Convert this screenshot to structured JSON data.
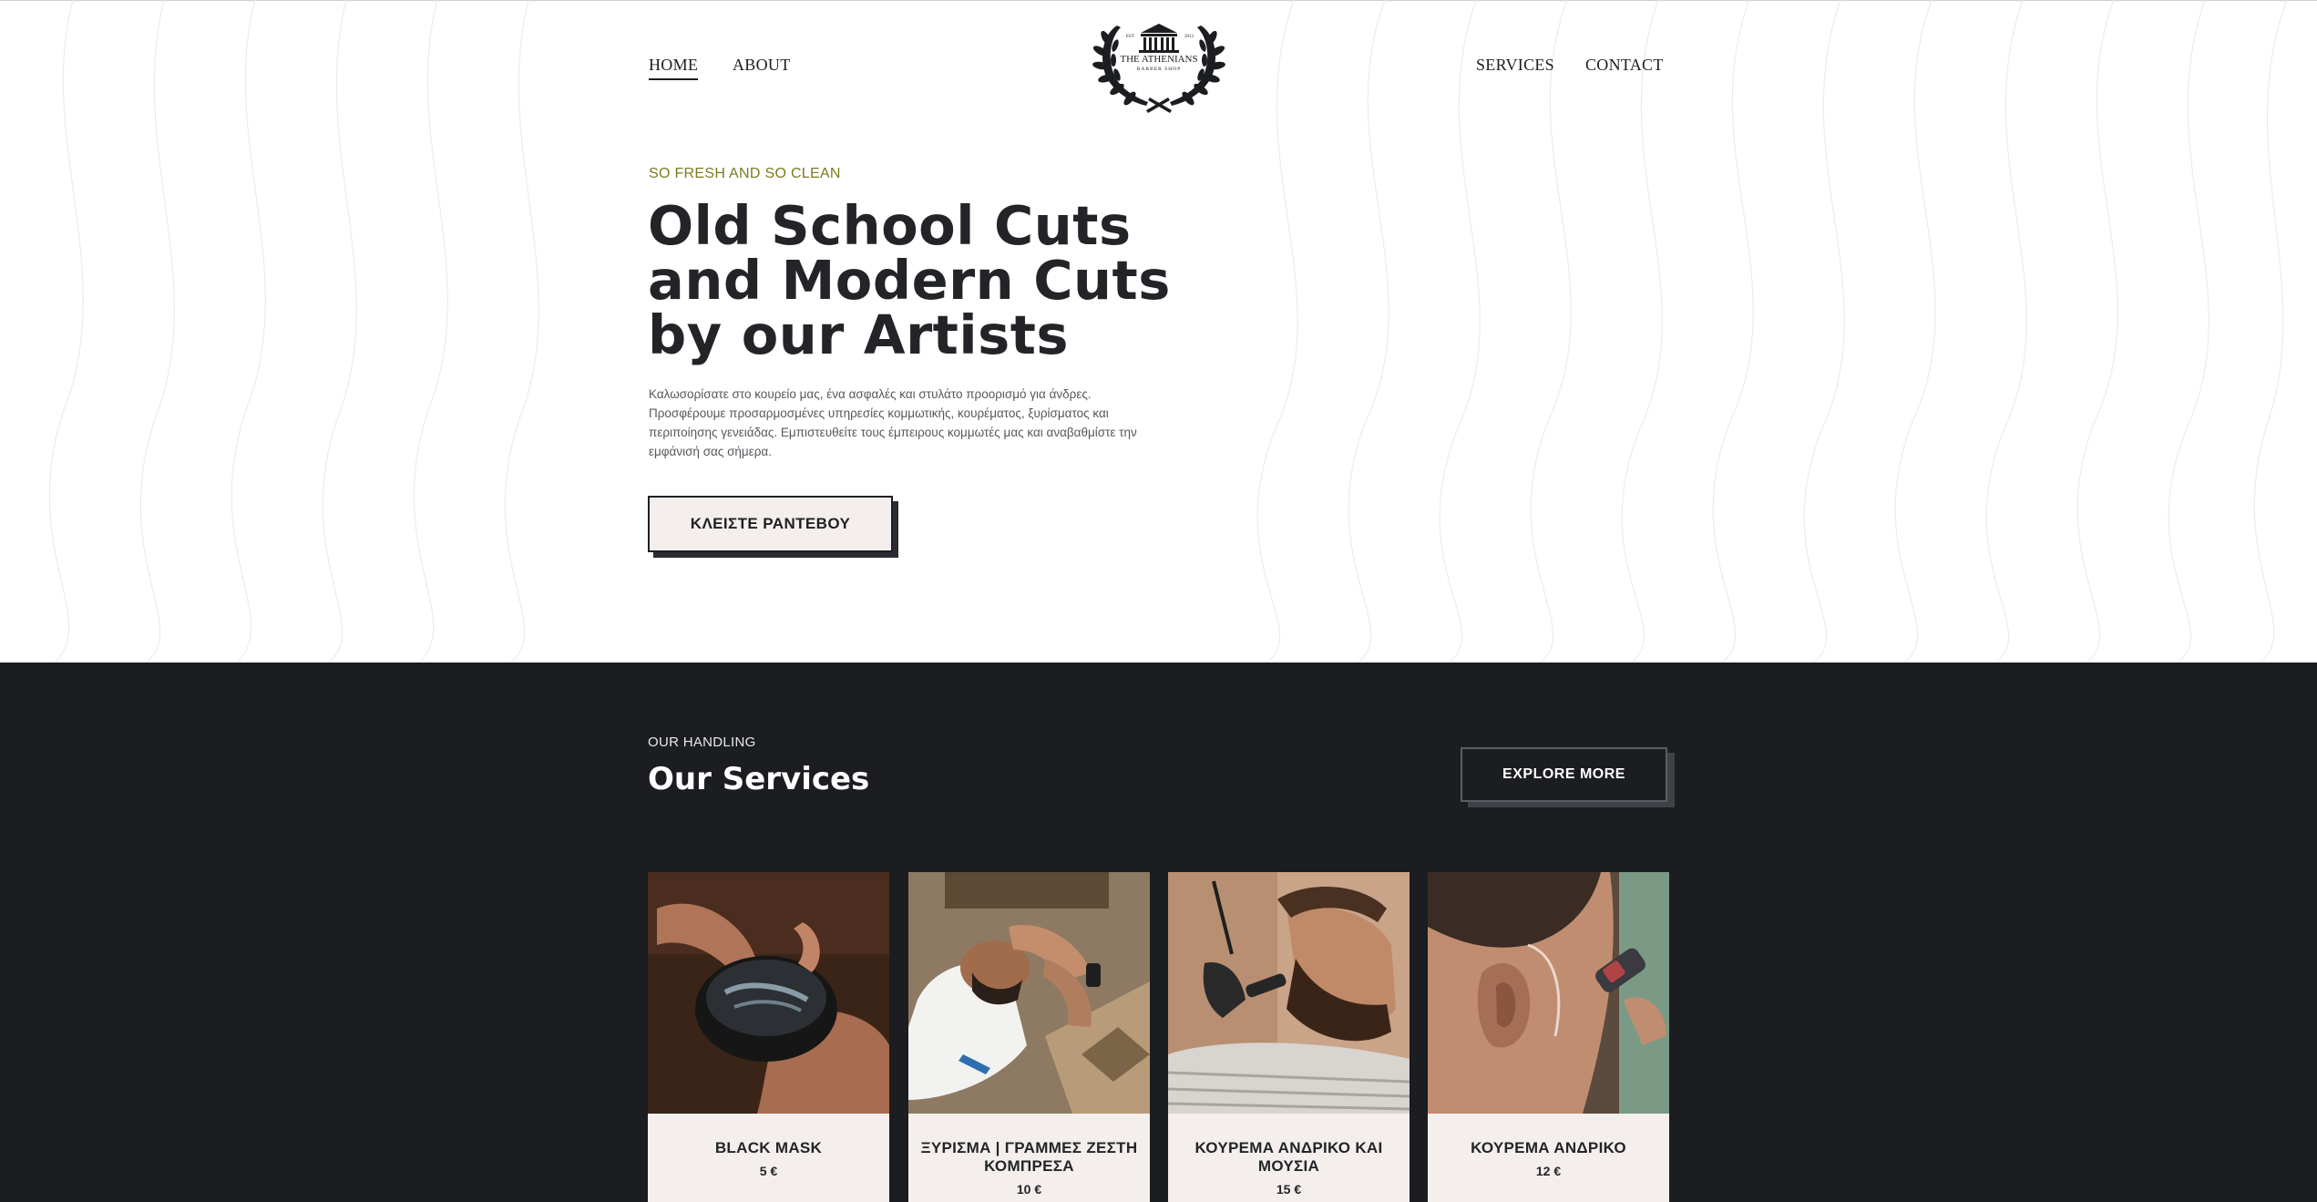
{
  "brand": {
    "name": "THE ATHENIANS",
    "tagline": "BARBER SHOP",
    "est_label": "EST",
    "est_year": "2013"
  },
  "nav": {
    "home": "HOME",
    "about": "ABOUT",
    "services": "SERVICES",
    "contact": "CONTACT",
    "active": "home"
  },
  "hero": {
    "eyebrow": "SO FRESH AND SO CLEAN",
    "title_lines": [
      "Old School Cuts",
      "and Modern Cuts",
      "by our Artists"
    ],
    "description": "Καλωσορίσατε στο κουρείο μας, ένα ασφαλές και στυλάτο προορισμό για άνδρες. Προσφέρουμε προσαρμοσμένες υπηρεσίες κομμωτικής, κουρέματος, ξυρίσματος και περιποίησης γενειάδας. Εμπιστευθείτε τους έμπειρους κομμωτές μας και αναβαθμίστε την εμφάνισή σας σήμερα.",
    "cta": "ΚΛΕΙΣΤΕ ΡΑΝΤΕΒΟΥ"
  },
  "services": {
    "eyebrow": "OUR HANDLING",
    "title": "Our Services",
    "explore": "EXPLORE MORE",
    "items": [
      {
        "name": "BLACK MASK",
        "price": "5 €",
        "image": "black-mask-jar-photo"
      },
      {
        "name": "ΞΥΡΙΣΜΑ | ΓΡΑΜΜΕΣ ΖΕΣΤΗ ΚΟΜΠΡΕΣΑ",
        "price": "10 €",
        "image": "hot-towel-shave-photo"
      },
      {
        "name": "ΚΟΥΡΕΜΑ ΑΝΔΡΙΚΟ ΚΑΙ ΜΟΥΣΙΑ",
        "price": "15 €",
        "image": "beard-trim-photo"
      },
      {
        "name": "ΚΟΥΡΕΜΑ ΑΝΔΡΙΚΟ",
        "price": "12 €",
        "image": "haircut-clipper-photo"
      }
    ]
  },
  "colors": {
    "dark": "#1b1d20",
    "accent_olive": "#7d7a1e",
    "card_bg": "#f4efec"
  }
}
